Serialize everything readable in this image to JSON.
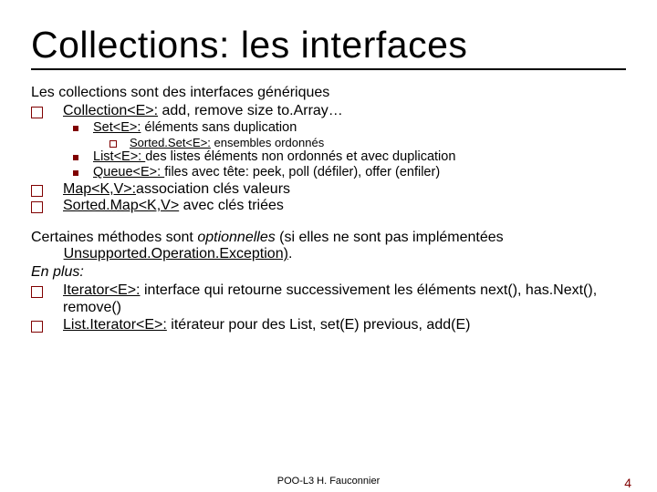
{
  "title": "Collections: les interfaces",
  "intro": "Les collections sont des interfaces génériques",
  "items1": [
    {
      "link": "Collection<E>:",
      "rest": " add, remove size to.Array…"
    }
  ],
  "items2a": [
    {
      "link": "Set<E>:",
      "rest": " éléments sans duplication"
    }
  ],
  "items3": [
    {
      "link": "Sorted.Set<E>:",
      "rest": " ensembles ordonnés"
    }
  ],
  "items2b": [
    {
      "link": "List<E>: ",
      "rest": "des listes éléments non ordonnés et avec duplication"
    },
    {
      "link": "Queue<E>: ",
      "rest": " files avec tête: peek, poll (défiler), offer (enfiler)"
    }
  ],
  "items1b": [
    {
      "link": "Map<K,V>:",
      "rest": "association clés valeurs"
    },
    {
      "link": "Sorted.Map<K,V>",
      "rest": " avec clés triées"
    }
  ],
  "para2_a": "Certaines méthodes sont ",
  "para2_b": "optionnelles",
  "para2_c": " (si elles ne sont pas implémentées ",
  "para2_d": "Unsupported.Operation.Exception)",
  "para2_e": ".",
  "enplus": "En plus:",
  "items1c": [
    {
      "link": "Iterator<E>:",
      "rest": " interface qui retourne successivement les éléments next(), has.Next(), remove()"
    },
    {
      "link": "List.Iterator<E>:",
      "rest": " itérateur pour des List, set(E) previous, add(E)"
    }
  ],
  "footer_center": "POO-L3 H. Fauconnier",
  "footer_page": "4"
}
